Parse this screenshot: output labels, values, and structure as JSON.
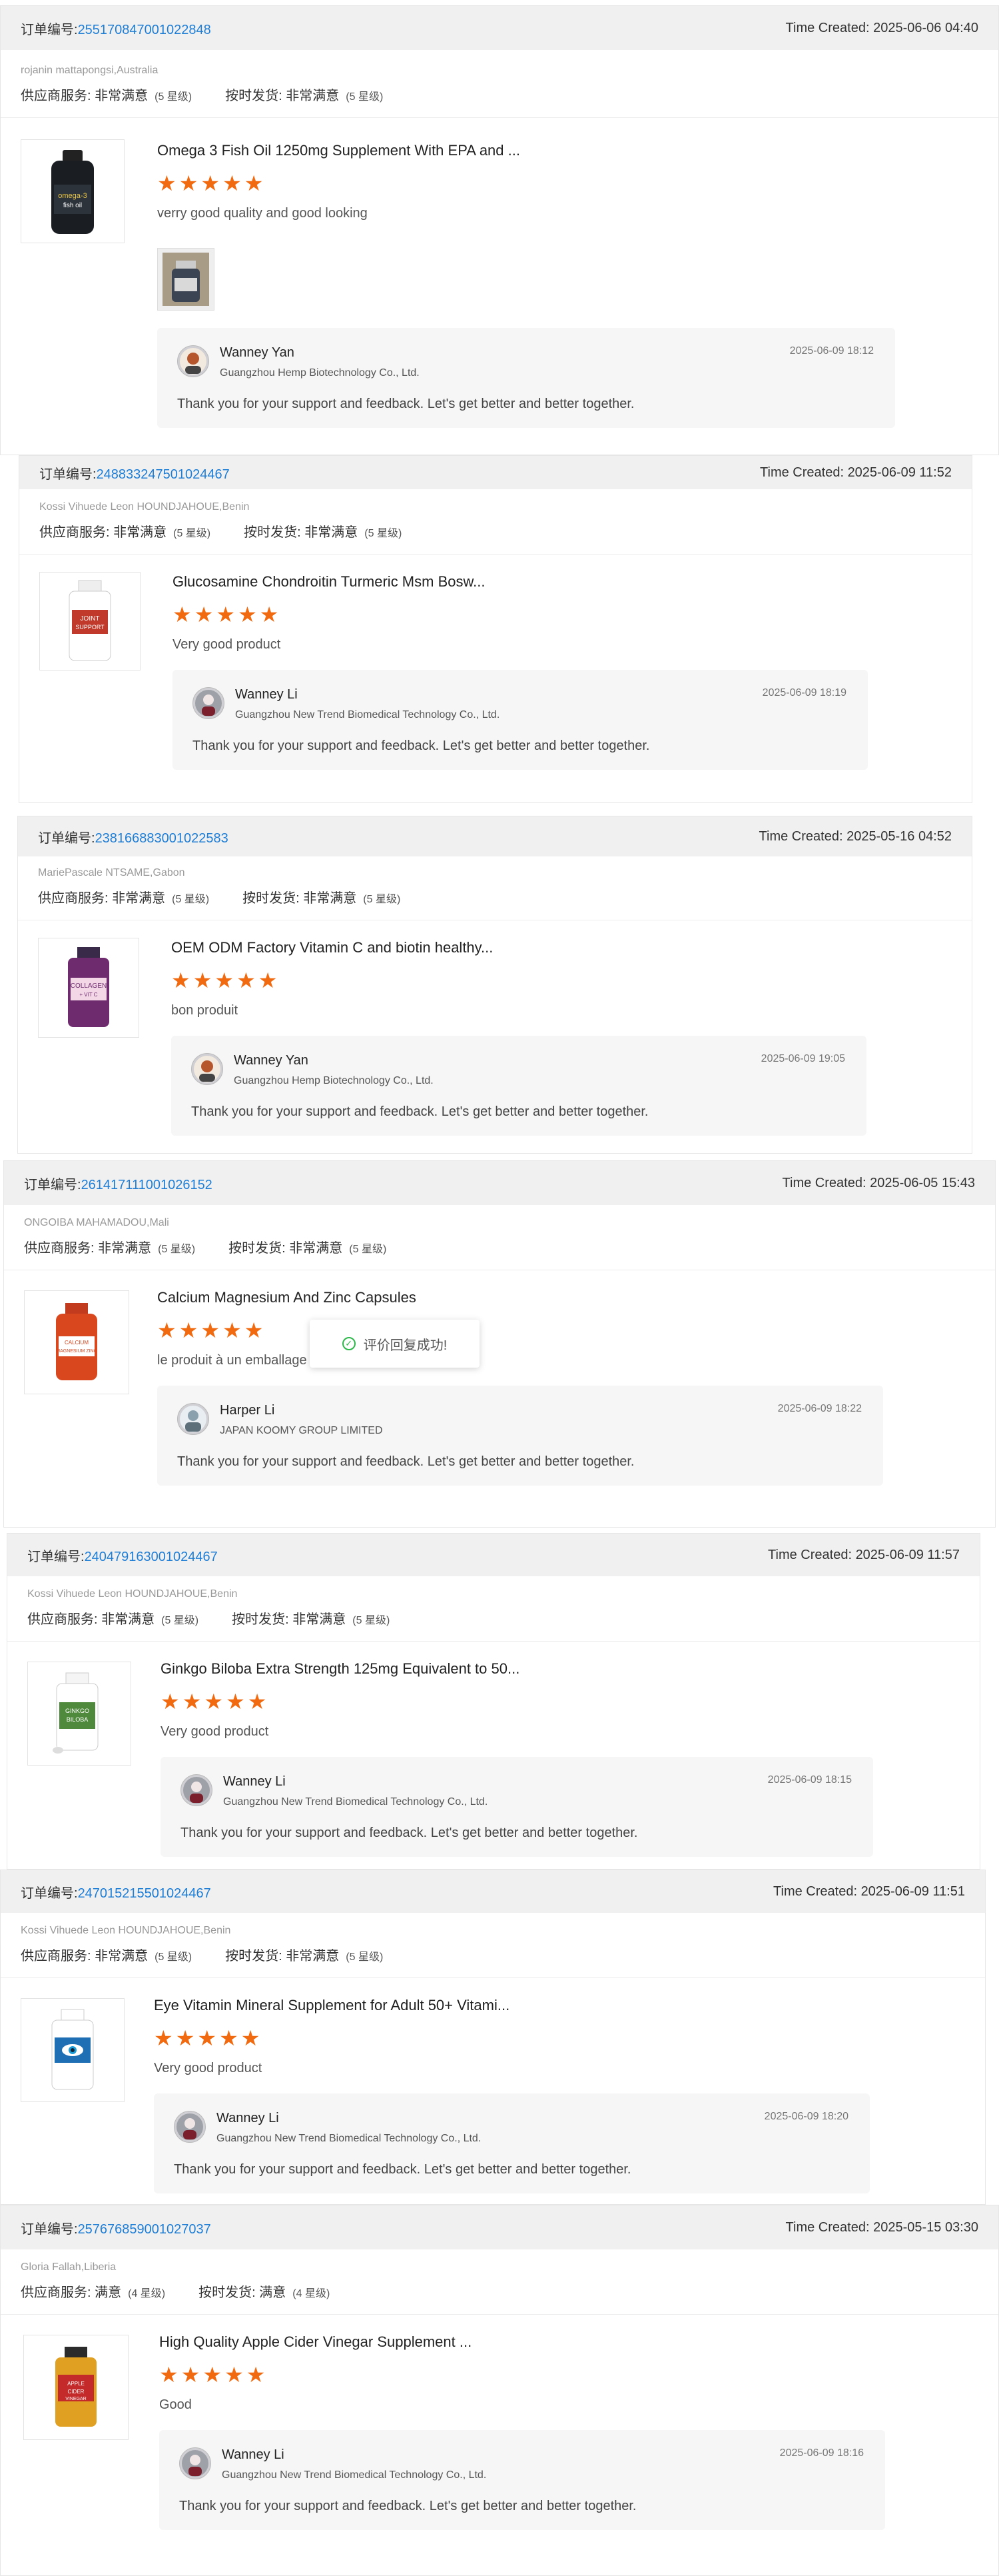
{
  "labels": {
    "order_no": "订单编号:",
    "time_created": "Time Created:",
    "supplier_service": "供应商服务:",
    "on_time_delivery": "按时发货:",
    "reply_text": "Thank you for your support and feedback. Let's get better and better together."
  },
  "toast": {
    "text": "评价回复成功!"
  },
  "colors": {
    "star": "#f26a10",
    "link": "#1e7ed6",
    "header_bg": "#f0f0f0"
  },
  "orders": [
    {
      "order_id": "255170847001022848",
      "time": "2025-06-06 04:40",
      "buyer": "rojanin mattapongsi,Australia",
      "service": "非常满意",
      "service_level": "(5 星级)",
      "delivery": "非常满意",
      "delivery_level": "(5 星级)",
      "product": "Omega 3 Fish Oil 1250mg Supplement With EPA and ...",
      "rating": 5,
      "review": "verry good quality and good looking",
      "reply_name": "Wanney Yan",
      "reply_company": "Guangzhou Hemp Biotechnology Co., Ltd.",
      "reply_date": "2025-06-09 18:12"
    },
    {
      "order_id": "248833247501024467",
      "time": "2025-06-09 11:52",
      "buyer": "Kossi Vihuede Leon HOUNDJAHOUE,Benin",
      "service": "非常满意",
      "service_level": "(5 星级)",
      "delivery": "非常满意",
      "delivery_level": "(5 星级)",
      "product": "Glucosamine Chondroitin Turmeric Msm Bosw...",
      "rating": 5,
      "review": "Very good product",
      "reply_name": "Wanney Li",
      "reply_company": "Guangzhou New Trend Biomedical Technology Co., Ltd.",
      "reply_date": "2025-06-09 18:19"
    },
    {
      "order_id": "238166883001022583",
      "time": "2025-05-16 04:52",
      "buyer": "MariePascale NTSAME,Gabon",
      "service": "非常满意",
      "service_level": "(5 星级)",
      "delivery": "非常满意",
      "delivery_level": "(5 星级)",
      "product": "OEM ODM Factory Vitamin C and biotin healthy...",
      "rating": 5,
      "review": "bon produit",
      "reply_name": "Wanney Yan",
      "reply_company": "Guangzhou Hemp Biotechnology Co., Ltd.",
      "reply_date": "2025-06-09 19:05"
    },
    {
      "order_id": "261417111001026152",
      "time": "2025-06-05 15:43",
      "buyer": "ONGOIBA MAHAMADOU,Mali",
      "service": "非常满意",
      "service_level": "(5 星级)",
      "delivery": "非常满意",
      "delivery_level": "(5 星级)",
      "product": "Calcium Magnesium And Zinc Capsules",
      "rating": 5,
      "review": "le produit à un emballage super comme sur la photo.",
      "reply_name": "Harper Li",
      "reply_company": "JAPAN KOOMY GROUP LIMITED",
      "reply_date": "2025-06-09 18:22"
    },
    {
      "order_id": "240479163001024467",
      "time": "2025-06-09 11:57",
      "buyer": "Kossi Vihuede Leon HOUNDJAHOUE,Benin",
      "service": "非常满意",
      "service_level": "(5 星级)",
      "delivery": "非常满意",
      "delivery_level": "(5 星级)",
      "product": "Ginkgo Biloba Extra Strength 125mg Equivalent to 50...",
      "rating": 5,
      "review": "Very good product",
      "reply_name": "Wanney Li",
      "reply_company": "Guangzhou New Trend Biomedical Technology Co., Ltd.",
      "reply_date": "2025-06-09 18:15"
    },
    {
      "order_id": "247015215501024467",
      "time": "2025-06-09 11:51",
      "buyer": "Kossi Vihuede Leon HOUNDJAHOUE,Benin",
      "service": "非常满意",
      "service_level": "(5 星级)",
      "delivery": "非常满意",
      "delivery_level": "(5 星级)",
      "product": "Eye Vitamin Mineral Supplement for Adult 50+ Vitami...",
      "rating": 5,
      "review": "Very good product",
      "reply_name": "Wanney Li",
      "reply_company": "Guangzhou New Trend Biomedical Technology Co., Ltd.",
      "reply_date": "2025-06-09 18:20"
    },
    {
      "order_id": "257676859001027037",
      "time": "2025-05-15 03:30",
      "buyer": "Gloria Fallah,Liberia",
      "service": "满意",
      "service_level": "(4 星级)",
      "delivery": "满意",
      "delivery_level": "(4 星级)",
      "product": "High Quality Apple Cider Vinegar Supplement ...",
      "rating": 5,
      "review": "Good",
      "reply_name": "Wanney Li",
      "reply_company": "Guangzhou New Trend Biomedical Technology Co., Ltd.",
      "reply_date": "2025-06-09 18:16"
    }
  ]
}
